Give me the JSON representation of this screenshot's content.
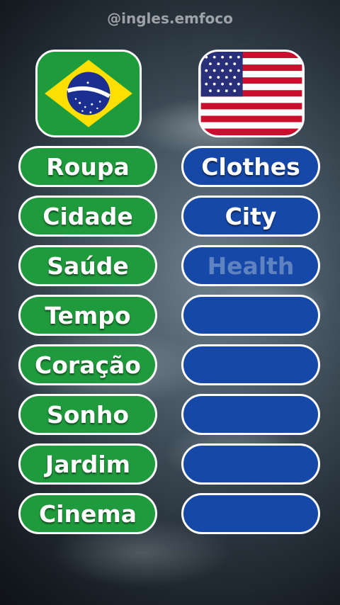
{
  "watermark": "@ingles.emfoco",
  "flags": {
    "left": {
      "icon": "brazil-flag-icon",
      "motto": "ORDEM E PROGRESSO"
    },
    "right": {
      "icon": "usa-flag-icon"
    }
  },
  "colors": {
    "green": "#1f9a3c",
    "blue": "#1648a8"
  },
  "portuguese_words": [
    "Roupa",
    "Cidade",
    "Saúde",
    "Tempo",
    "Coração",
    "Sonho",
    "Jardim",
    "Cinema"
  ],
  "english_words": [
    "Clothes",
    "City",
    "Health",
    "",
    "",
    "",
    "",
    ""
  ]
}
